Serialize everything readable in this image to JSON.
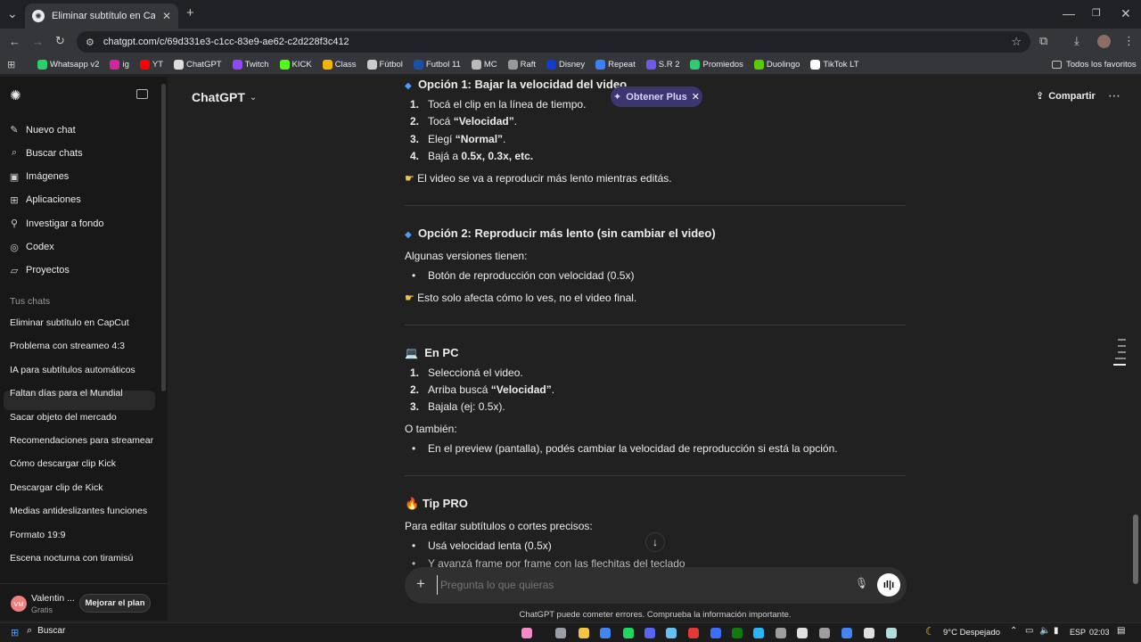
{
  "browser": {
    "tab_title": "Eliminar subtítulo en CapCut",
    "url": "chatgpt.com/c/69d331e3-c1cc-83e9-ae62-c2d228f3c412",
    "bookmarks": [
      {
        "label": "Whatsapp v2",
        "color": "#25d366"
      },
      {
        "label": "ig",
        "color": "#d6249f"
      },
      {
        "label": "YT",
        "color": "#ff0000"
      },
      {
        "label": "ChatGPT",
        "color": "#dddddd"
      },
      {
        "label": "Twitch",
        "color": "#9146ff"
      },
      {
        "label": "KICK",
        "color": "#53fc18"
      },
      {
        "label": "Class",
        "color": "#f4b400"
      },
      {
        "label": "Fútbol",
        "color": "#cccccc"
      },
      {
        "label": "Futbol 11",
        "color": "#1e4fa8"
      },
      {
        "label": "MC",
        "color": "#bbbbbb"
      },
      {
        "label": "Raft",
        "color": "#999999"
      },
      {
        "label": "Disney",
        "color": "#113ccf"
      },
      {
        "label": "Repeat",
        "color": "#3b82f6"
      },
      {
        "label": "S.R 2",
        "color": "#6c5ce7"
      },
      {
        "label": "Promiedos",
        "color": "#2ecc71"
      },
      {
        "label": "Duolingo",
        "color": "#58cc02"
      },
      {
        "label": "TikTok LT",
        "color": "#ffffff"
      }
    ],
    "all_bookmarks": "Todos los favoritos"
  },
  "sidebar": {
    "nav": [
      {
        "label": "Nuevo chat",
        "icon": "edit-icon"
      },
      {
        "label": "Buscar chats",
        "icon": "search-icon"
      },
      {
        "label": "Imágenes",
        "icon": "image-icon"
      },
      {
        "label": "Aplicaciones",
        "icon": "apps-icon"
      },
      {
        "label": "Investigar a fondo",
        "icon": "research-icon"
      },
      {
        "label": "Codex",
        "icon": "codex-icon"
      },
      {
        "label": "Proyectos",
        "icon": "folder-icon"
      }
    ],
    "section_title": "Tus chats",
    "chats": [
      "Eliminar subtítulo en CapCut",
      "Problema con streameo 4:3",
      "IA para subtítulos automáticos",
      "Faltan días para el Mundial",
      "Sacar objeto del mercado",
      "Recomendaciones para streamear",
      "Cómo descargar clip Kick",
      "Descargar clip de Kick",
      "Medias antideslizantes funciones",
      "Formato 19:9",
      "Escena nocturna con tiramisú"
    ],
    "user": {
      "initials": "VM",
      "name": "Valentin ...",
      "plan": "Gratis"
    },
    "upgrade": "Mejorar el plan"
  },
  "header": {
    "model": "ChatGPT",
    "get_plus": "Obtener Plus",
    "share": "Compartir"
  },
  "content": {
    "opt1_title": "Opción 1: Bajar la velocidad del video",
    "opt1_steps": [
      "1.",
      "2.",
      "3.",
      "4."
    ],
    "opt1_s1": "Tocá el clip en la línea de tiempo.",
    "opt1_s2a": "Tocá ",
    "opt1_s2b": "“Velocidad”",
    "opt1_s2c": ".",
    "opt1_s3a": "Elegí ",
    "opt1_s3b": "“Normal”",
    "opt1_s3c": ".",
    "opt1_s4a": "Bajá a ",
    "opt1_s4b": "0.5x, 0.3x, etc.",
    "opt1_note": "El video se va a reproducir más lento mientras editás.",
    "opt2_title": "Opción 2: Reproducir más lento (sin cambiar el video)",
    "opt2_intro": "Algunas versiones tienen:",
    "opt2_b1": "Botón de reproducción con velocidad (0.5x)",
    "opt2_note": "Esto solo afecta cómo lo ves, no el video final.",
    "pc_title": "En PC",
    "pc_s1": "Seleccioná el video.",
    "pc_s2a": "Arriba buscá ",
    "pc_s2b": "“Velocidad”",
    "pc_s2c": ".",
    "pc_s3": "Bajala (ej: 0.5x).",
    "also": "O también:",
    "also_b1": "En el preview (pantalla), podés cambiar la velocidad de reproducción si está la opción.",
    "tip_title": "Tip PRO",
    "tip_intro": "Para editar subtítulos o cortes precisos:",
    "tip_b1": "Usá velocidad lenta (0.5x)",
    "tip_b2": "Y avanzá frame por frame con las flechitas del teclado"
  },
  "composer": {
    "placeholder": "Pregunta lo que quieras",
    "disclaimer": "ChatGPT puede cometer errores. Comprueba la información importante."
  },
  "taskbar": {
    "search": "Buscar",
    "weather": "9°C  Despejado",
    "lang": "ESP",
    "time": "02:03"
  }
}
